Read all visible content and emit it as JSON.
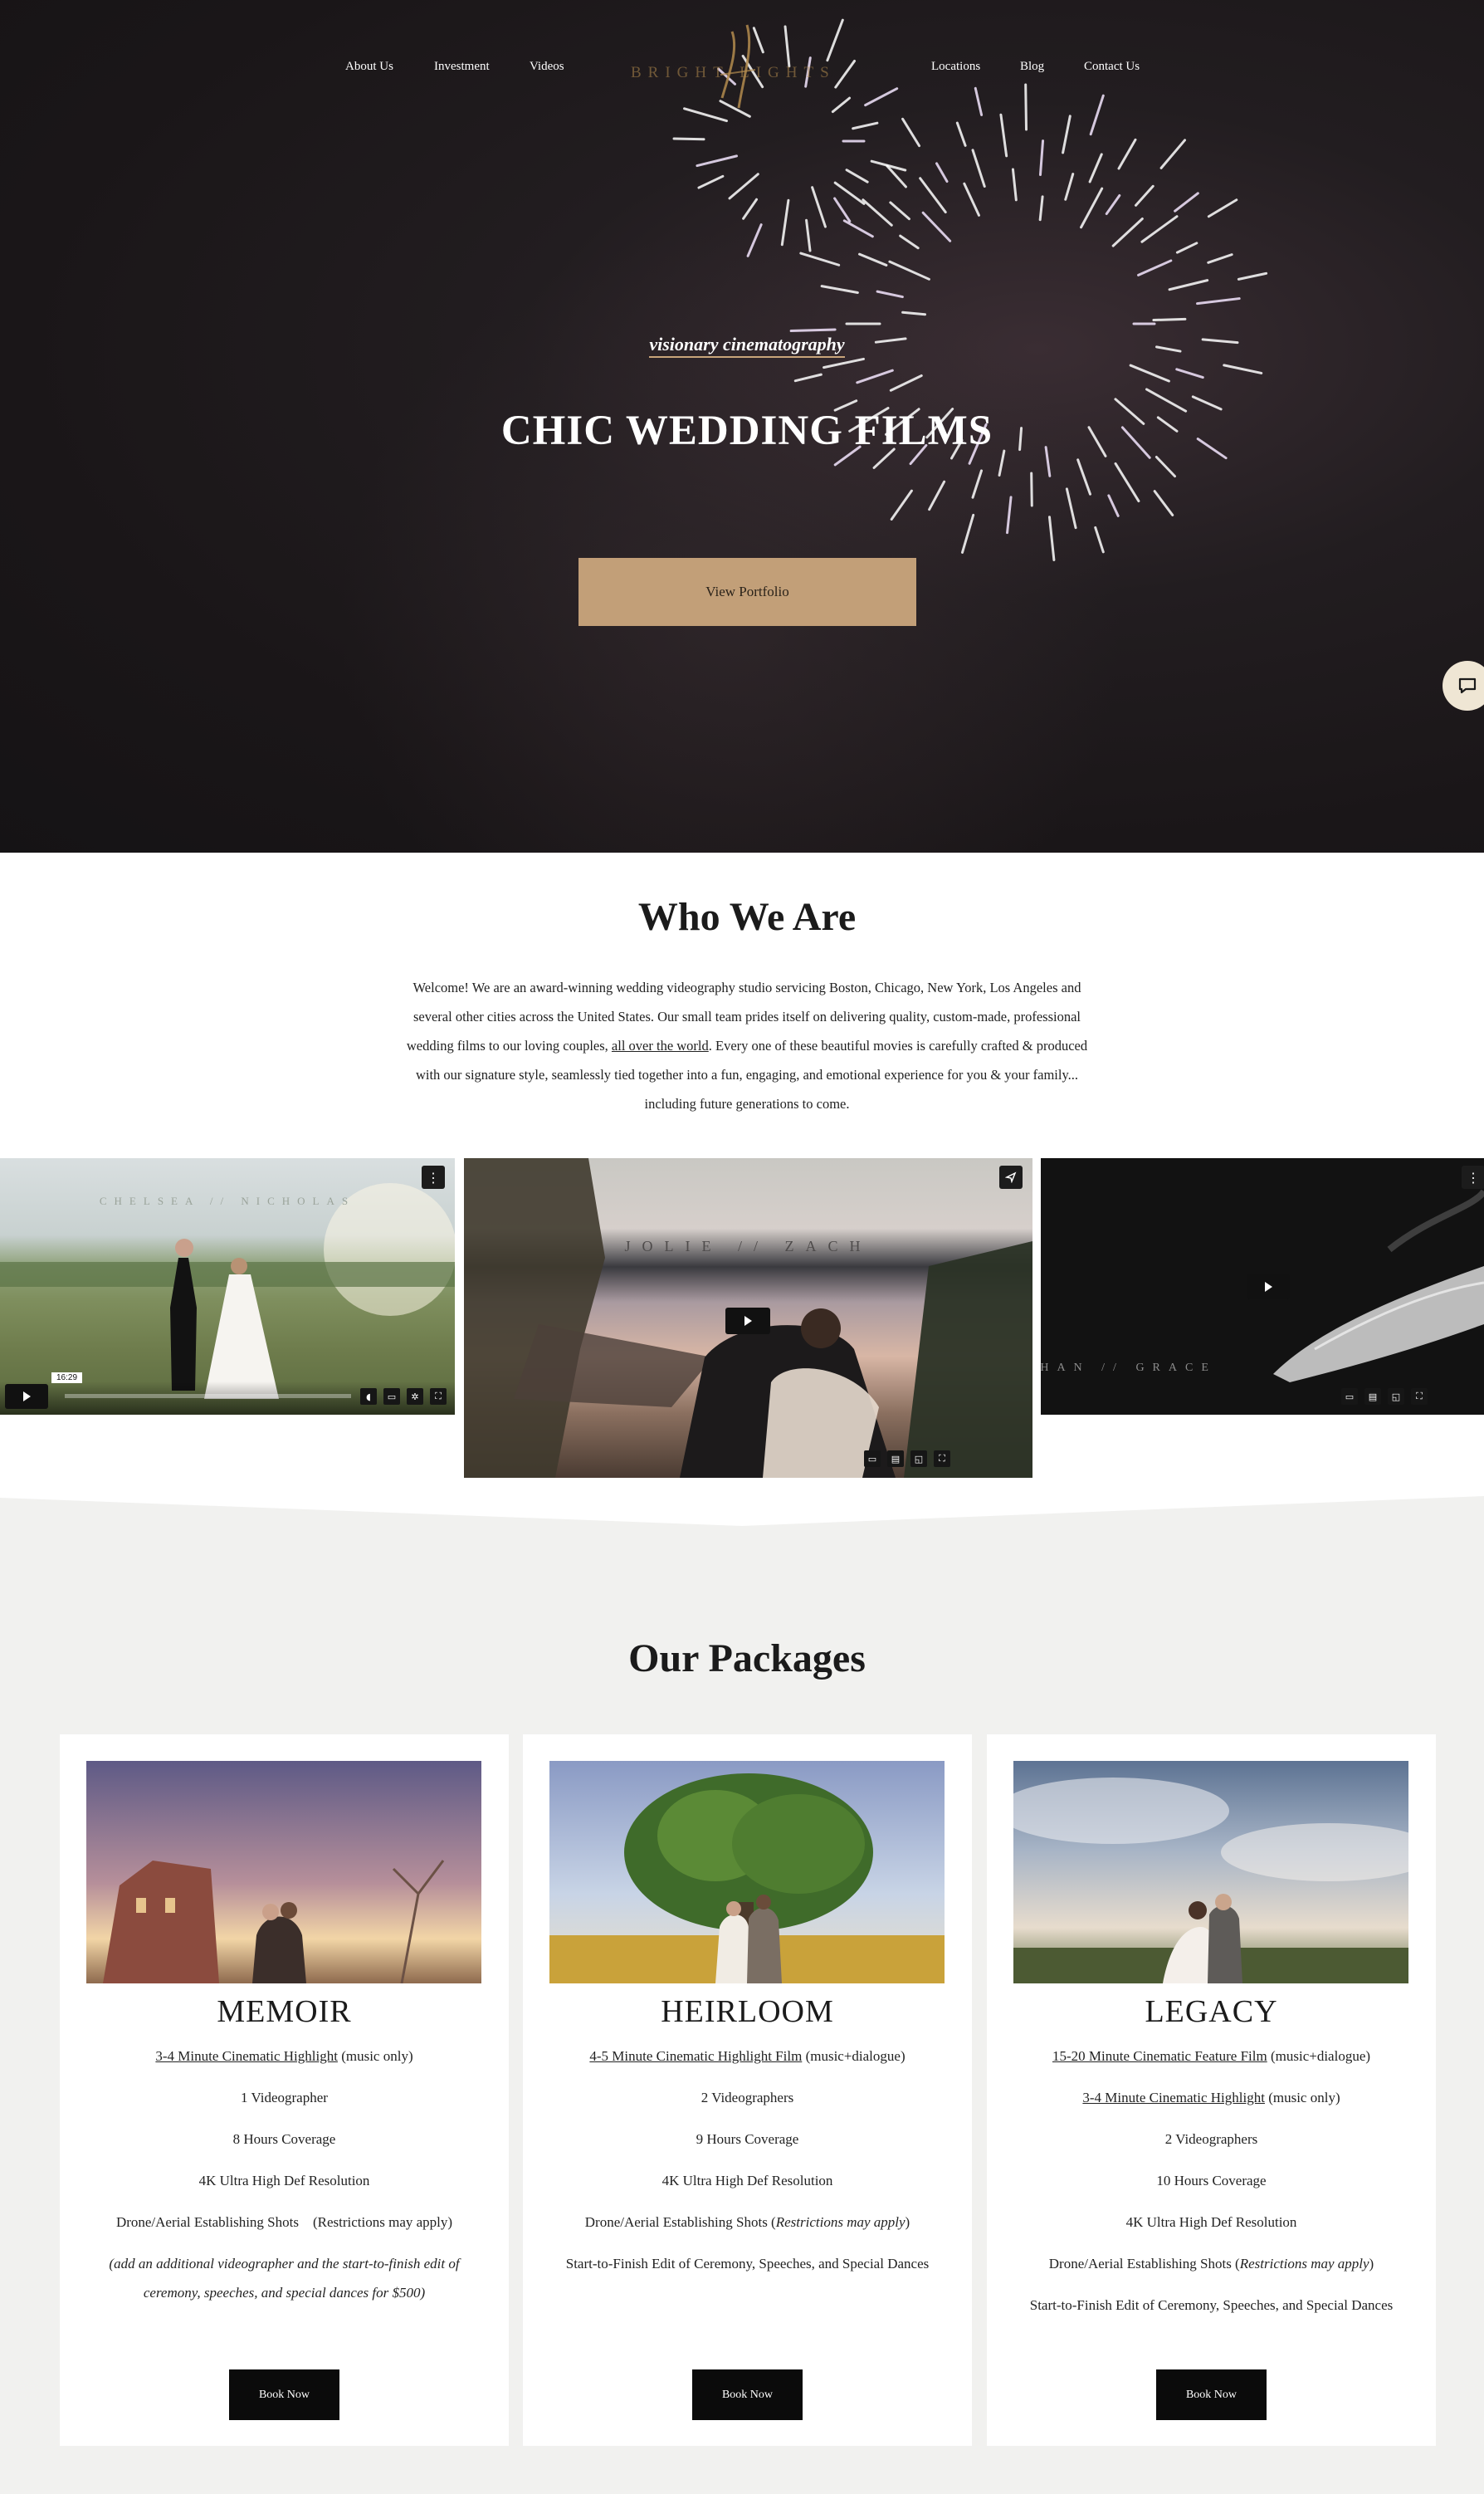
{
  "nav": {
    "left": [
      "About Us",
      "Investment",
      "Videos"
    ],
    "right": [
      "Locations",
      "Blog",
      "Contact Us"
    ],
    "logo_text": "BRIGHT LIGHTS"
  },
  "hero": {
    "tagline": "visionary cinematography",
    "title": "CHIC WEDDING FILMS",
    "button": "View Portfolio"
  },
  "who": {
    "title": "Who We Are",
    "text_before_link": "Welcome! We are an award-winning wedding videography studio servicing Boston, Chicago, New York, Los Angeles and several other cities across the United States. Our small team prides itself on delivering quality, custom-made, professional wedding films to our loving couples, ",
    "link": "all over the world",
    "text_after_link": ". Every one of these beautiful movies is carefully crafted & produced with our signature style, seamlessly tied together into a fun, engaging, and emotional experience for you & your family... including future generations to come."
  },
  "videos": [
    {
      "label": "CHELSEA // NICHOLAS",
      "time_tooltip": "16:29"
    },
    {
      "label": "JOLIE // ZACH"
    },
    {
      "label": "NATHAN // GRACE"
    }
  ],
  "packages": {
    "title": "Our Packages",
    "cards": [
      {
        "name": "MEMOIR",
        "f1_link": "3-4 Minute Cinematic Highlight",
        "f1_rest": " (music only)",
        "f2": "1 Videographer",
        "f3": "8 Hours Coverage",
        "f4": "4K Ultra High Def Resolution",
        "f5": "Drone/Aerial Establishing Shots    (Restrictions may apply)",
        "f6": "(add an additional videographer and the start-to-finish edit of ceremony, speeches, and special dances for $500)",
        "button": "Book Now"
      },
      {
        "name": "HEIRLOOM",
        "f1_link": "4-5 Minute Cinematic Highlight Film",
        "f1_rest": " (music+dialogue)",
        "f2": "2 Videographers",
        "f3": "9 Hours Coverage",
        "f4": "4K Ultra High Def Resolution",
        "f5_a": "Drone/Aerial Establishing Shots (",
        "f5_em": "Restrictions may apply",
        "f5_b": ")",
        "f6": "Start-to-Finish Edit of Ceremony, Speeches, and Special Dances",
        "button": "Book Now"
      },
      {
        "name": "LEGACY",
        "f1_link": "15-20 Minute Cinematic Feature Film",
        "f1_rest": " (music+dialogue)",
        "f2_link": "3-4 Minute Cinematic Highlight",
        "f2_rest": " (music only)",
        "f3": "2 Videographers",
        "f4": "10 Hours Coverage",
        "f5": "4K Ultra High Def Resolution",
        "f6_a": "Drone/Aerial Establishing Shots (",
        "f6_em": "Restrictions may apply",
        "f6_b": ")",
        "f7": "Start-to-Finish Edit of Ceremony, Speeches, and Special Dances",
        "button": "Book Now"
      }
    ]
  },
  "colors": {
    "accent": "#c29f78",
    "dark": "#0b0b0b",
    "page_bg": "#f1f1ef"
  }
}
